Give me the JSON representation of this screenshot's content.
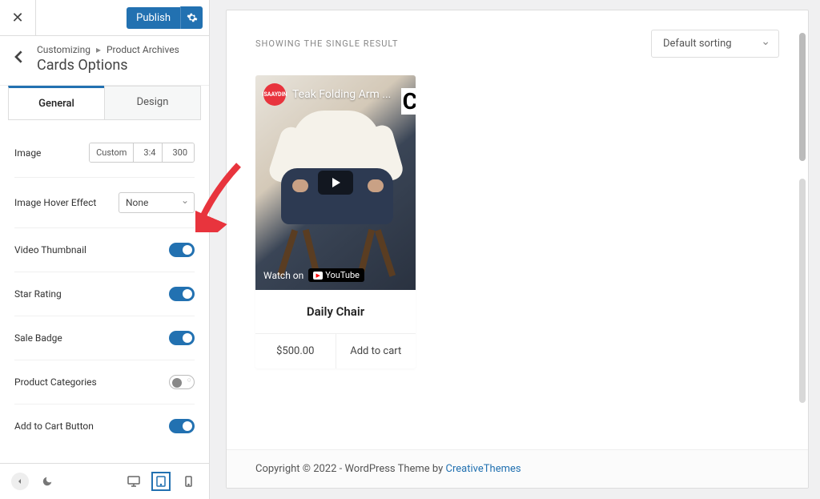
{
  "header": {
    "publish_label": "Publish"
  },
  "breadcrumb": {
    "root": "Customizing",
    "parent": "Product Archives",
    "title": "Cards Options"
  },
  "tabs": {
    "general": "General",
    "design": "Design"
  },
  "options": {
    "image": {
      "label": "Image",
      "seg1": "Custom",
      "seg2": "3:4",
      "seg3": "300"
    },
    "hover": {
      "label": "Image Hover Effect",
      "value": "None"
    },
    "video_thumb": {
      "label": "Video Thumbnail"
    },
    "star_rating": {
      "label": "Star Rating"
    },
    "sale_badge": {
      "label": "Sale Badge"
    },
    "product_categories": {
      "label": "Product Categories"
    },
    "add_to_cart": {
      "label": "Add to Cart Button"
    }
  },
  "preview": {
    "result_text": "Showing the single result",
    "sort_label": "Default sorting",
    "channel": "ISAAYDIN",
    "video_title": "Teak Folding Arm ...",
    "watch_on": "Watch on",
    "youtube": "YouTube",
    "product_name": "Daily Chair",
    "price": "$500.00",
    "add_to_cart": "Add to cart",
    "copyright_pre": "Copyright © 2022 - WordPress Theme by ",
    "copyright_link": "CreativeThemes"
  }
}
